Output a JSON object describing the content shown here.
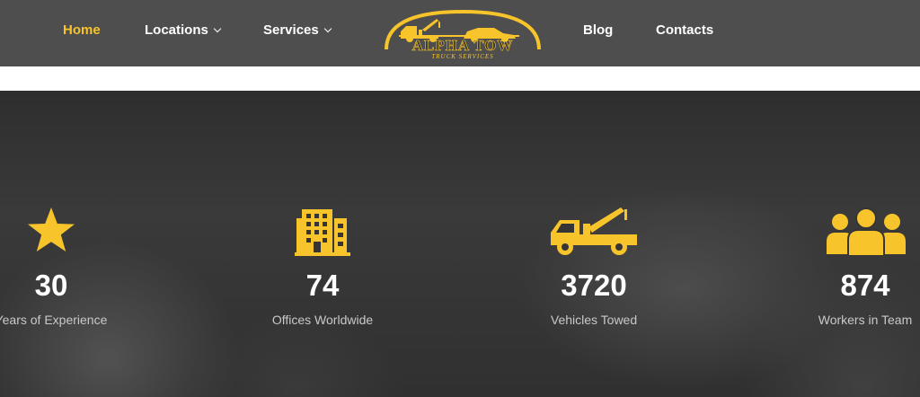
{
  "nav": {
    "home": "Home",
    "locations": "Locations",
    "services": "Services",
    "blog": "Blog",
    "contacts": "Contacts"
  },
  "logo": {
    "title": "ALPHA TOW",
    "subtitle": "TRUCK SERVICES"
  },
  "colors": {
    "accent": "#f7c52b",
    "header_bg": "#4e4e4e",
    "text": "#ffffff"
  },
  "stats": [
    {
      "icon": "star-icon",
      "number": "30",
      "label": "Years of Experience"
    },
    {
      "icon": "building-icon",
      "number": "74",
      "label": "Offices Worldwide"
    },
    {
      "icon": "tow-truck-icon",
      "number": "3720",
      "label": "Vehicles Towed"
    },
    {
      "icon": "workers-team-icon",
      "number": "874",
      "label": "Workers in Team"
    }
  ]
}
